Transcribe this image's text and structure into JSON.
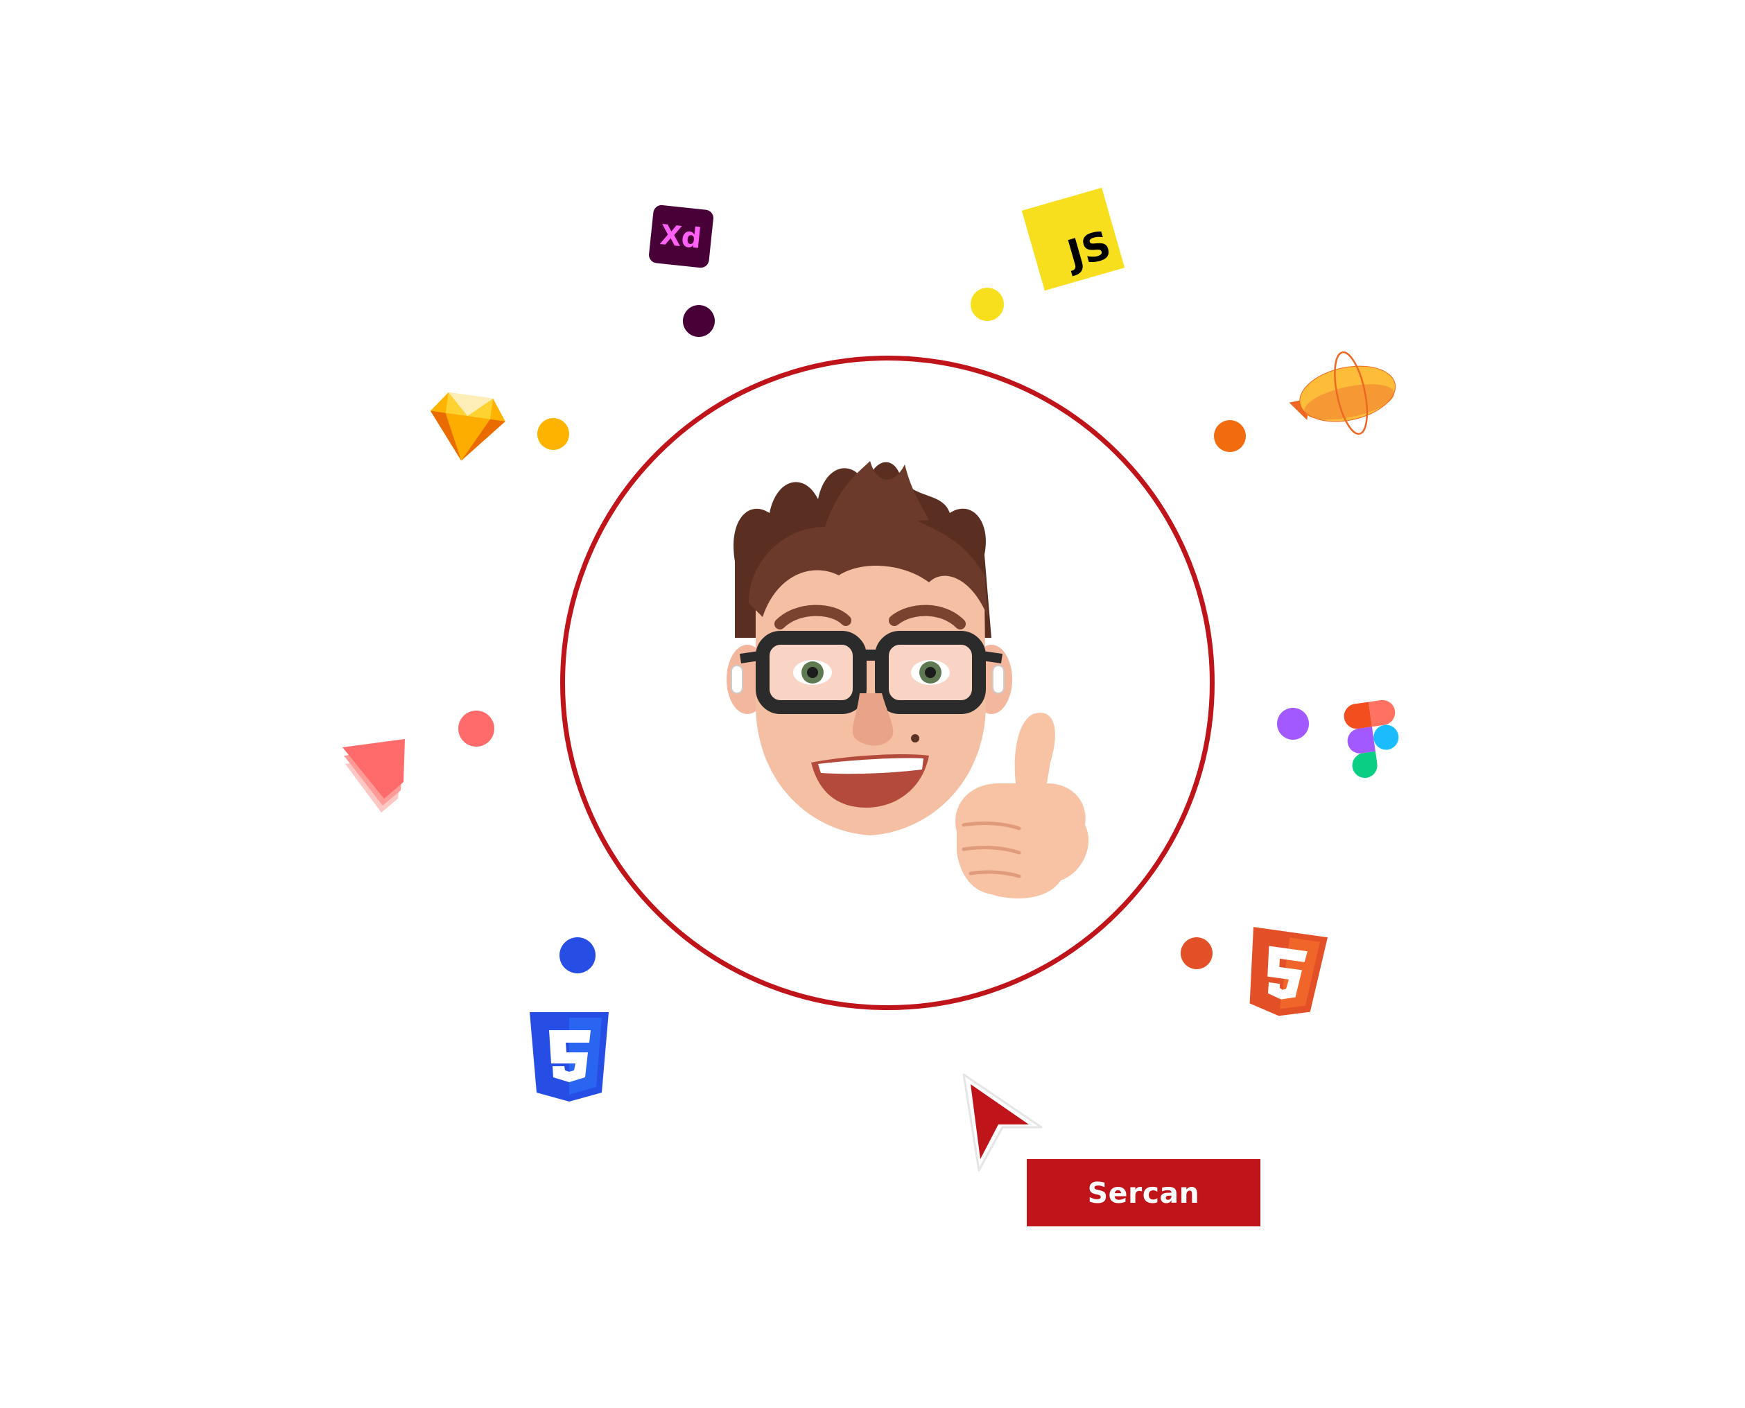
{
  "name_tag": {
    "label": "Sercan",
    "background": "#c0141b",
    "text_color": "#ffffff"
  },
  "profile_ring": {
    "color": "#c0141b"
  },
  "avatar": {
    "icon": "memoji-thumbs-up-avatar-icon"
  },
  "cursor": {
    "icon": "pointer-cursor-icon",
    "color": "#c0141b"
  },
  "tools": [
    {
      "id": "xd",
      "icon": "adobe-xd-icon",
      "label": "Xd",
      "color": "#470137",
      "accent": "#ff61f6",
      "dot_color": "#470137"
    },
    {
      "id": "js",
      "icon": "javascript-icon",
      "label": "JS",
      "color": "#f7df1e",
      "dot_color": "#f7df1e"
    },
    {
      "id": "sketch",
      "icon": "sketch-icon",
      "color": "#fdb300",
      "dot_color": "#fdb300"
    },
    {
      "id": "zeplin",
      "icon": "zeplin-icon",
      "color": "#fdbd39",
      "dot_color": "#f26c0f"
    },
    {
      "id": "principle",
      "icon": "principle-icon",
      "color": "#ff6b6b",
      "dot_color": "#ff6b6b"
    },
    {
      "id": "figma",
      "icon": "figma-icon",
      "color": "#a259ff",
      "dot_color": "#a259ff"
    },
    {
      "id": "css3",
      "icon": "css3-icon",
      "color": "#264de4",
      "dot_color": "#264de4"
    },
    {
      "id": "html5",
      "icon": "html5-icon",
      "color": "#e34f26",
      "dot_color": "#e34f26"
    }
  ]
}
